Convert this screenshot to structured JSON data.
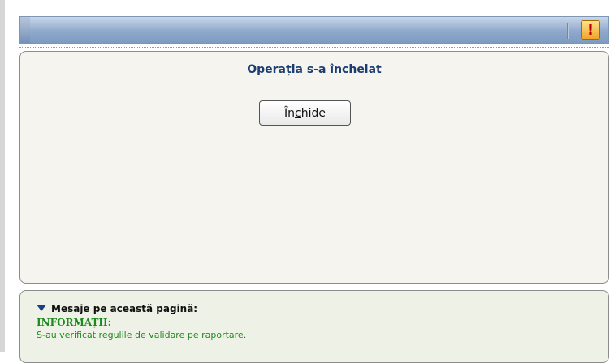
{
  "header": {
    "alert_glyph": "!"
  },
  "main": {
    "title": "Operația s-a încheiat",
    "close_button": {
      "before_mnemonic": "În",
      "mnemonic": "c",
      "after_mnemonic": "hide"
    }
  },
  "messages": {
    "header": "Mesaje pe această pagină:",
    "info_title": "INFORMAȚII:",
    "info_text": "S-au verificat regulile de validare pe raportare."
  },
  "colors": {
    "title": "#1b3d72",
    "info": "#1e8a1e",
    "panel_bg": "#f5f4ee",
    "message_bg": "#eef2e6",
    "header_bar": "#8fa9cc"
  }
}
